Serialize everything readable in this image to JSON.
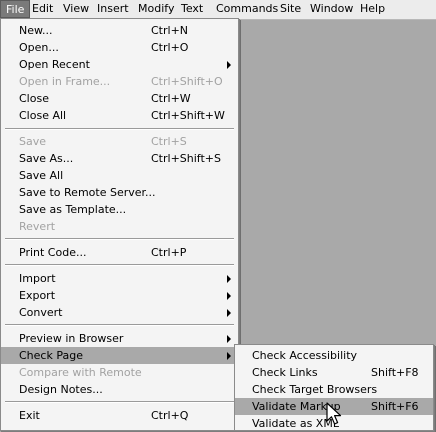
{
  "menubar": {
    "items": [
      "File",
      "Edit",
      "View",
      "Insert",
      "Modify",
      "Text",
      "Commands",
      "Site",
      "Window",
      "Help"
    ],
    "active": "File"
  },
  "file_menu": {
    "new": {
      "label": "New...",
      "shortcut": "Ctrl+N"
    },
    "open": {
      "label": "Open...",
      "shortcut": "Ctrl+O"
    },
    "open_recent": {
      "label": "Open Recent"
    },
    "open_in_frame": {
      "label": "Open in Frame...",
      "shortcut": "Ctrl+Shift+O"
    },
    "close": {
      "label": "Close",
      "shortcut": "Ctrl+W"
    },
    "close_all": {
      "label": "Close All",
      "shortcut": "Ctrl+Shift+W"
    },
    "save": {
      "label": "Save",
      "shortcut": "Ctrl+S"
    },
    "save_as": {
      "label": "Save As...",
      "shortcut": "Ctrl+Shift+S"
    },
    "save_all": {
      "label": "Save All"
    },
    "save_remote": {
      "label": "Save to Remote Server..."
    },
    "save_template": {
      "label": "Save as Template..."
    },
    "revert": {
      "label": "Revert"
    },
    "print_code": {
      "label": "Print Code...",
      "shortcut": "Ctrl+P"
    },
    "import": {
      "label": "Import"
    },
    "export": {
      "label": "Export"
    },
    "convert": {
      "label": "Convert"
    },
    "preview": {
      "label": "Preview in Browser"
    },
    "check_page": {
      "label": "Check Page"
    },
    "compare_remote": {
      "label": "Compare with Remote"
    },
    "design_notes": {
      "label": "Design Notes..."
    },
    "exit": {
      "label": "Exit",
      "shortcut": "Ctrl+Q"
    }
  },
  "check_page_submenu": {
    "accessibility": {
      "label": "Check Accessibility"
    },
    "links": {
      "label": "Check Links",
      "shortcut": "Shift+F8"
    },
    "target_browsers": {
      "label": "Check Target Browsers"
    },
    "validate_markup": {
      "label": "Validate Markup",
      "shortcut": "Shift+F6"
    },
    "validate_xml": {
      "label": "Validate as XML"
    }
  },
  "colors": {
    "desktop": "#a9a9a9",
    "menu_bg": "#f4f4f4",
    "highlight": "#a9a9a9",
    "disabled_text": "#a2a2a2"
  },
  "cursor_icon": "arrow-pointer"
}
